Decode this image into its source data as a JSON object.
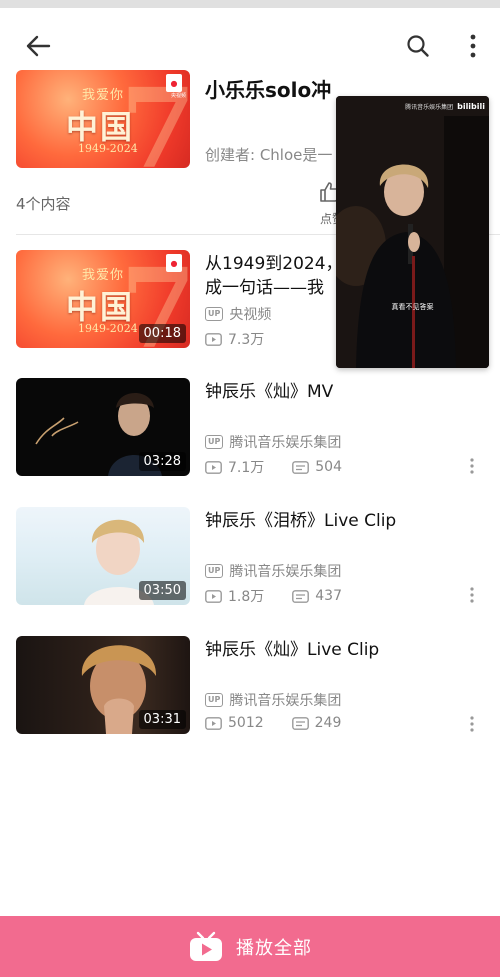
{
  "collection": {
    "title": "小乐乐solo冲",
    "creator": "创建者: Chloe是一",
    "count": "4个内容",
    "like_label": "点赞",
    "cover": {
      "small": "我爱你",
      "big": "中国",
      "years": "1949-2024",
      "logo": "央视频"
    }
  },
  "videos": [
    {
      "title": "从1949到2024，\n成一句话——我",
      "uploader": "央视频",
      "views": "7.3万",
      "duration": "00:18",
      "thumb": "cover"
    },
    {
      "title": "钟辰乐《灿》MV",
      "uploader": "腾讯音乐娱乐集团",
      "views": "7.1万",
      "comments": "504",
      "duration": "03:28",
      "thumb": "mv1"
    },
    {
      "title": "钟辰乐《泪桥》Live Clip",
      "uploader": "腾讯音乐娱乐集团",
      "views": "1.8万",
      "comments": "437",
      "duration": "03:50",
      "thumb": "mv2"
    },
    {
      "title": "钟辰乐《灿》Live Clip",
      "uploader": "腾讯音乐娱乐集团",
      "views": "5012",
      "comments": "249",
      "duration": "03:31",
      "thumb": "mv3"
    }
  ],
  "pip": {
    "brand": "腾讯音乐娱乐集团",
    "site": "bilibili",
    "subtitle": "真看不见答案"
  },
  "play_all": {
    "label": "播放全部"
  },
  "icons": {
    "back": "arrow-left-icon",
    "search": "search-icon",
    "more": "more-vertical-icon",
    "like": "thumb-up-icon",
    "up": "up-tag-icon",
    "play": "play-count-icon",
    "danmaku": "danmaku-count-icon",
    "play_all": "tv-play-icon"
  },
  "colors": {
    "accent": "#f26b8f",
    "text": "#111111",
    "muted": "#888888"
  }
}
